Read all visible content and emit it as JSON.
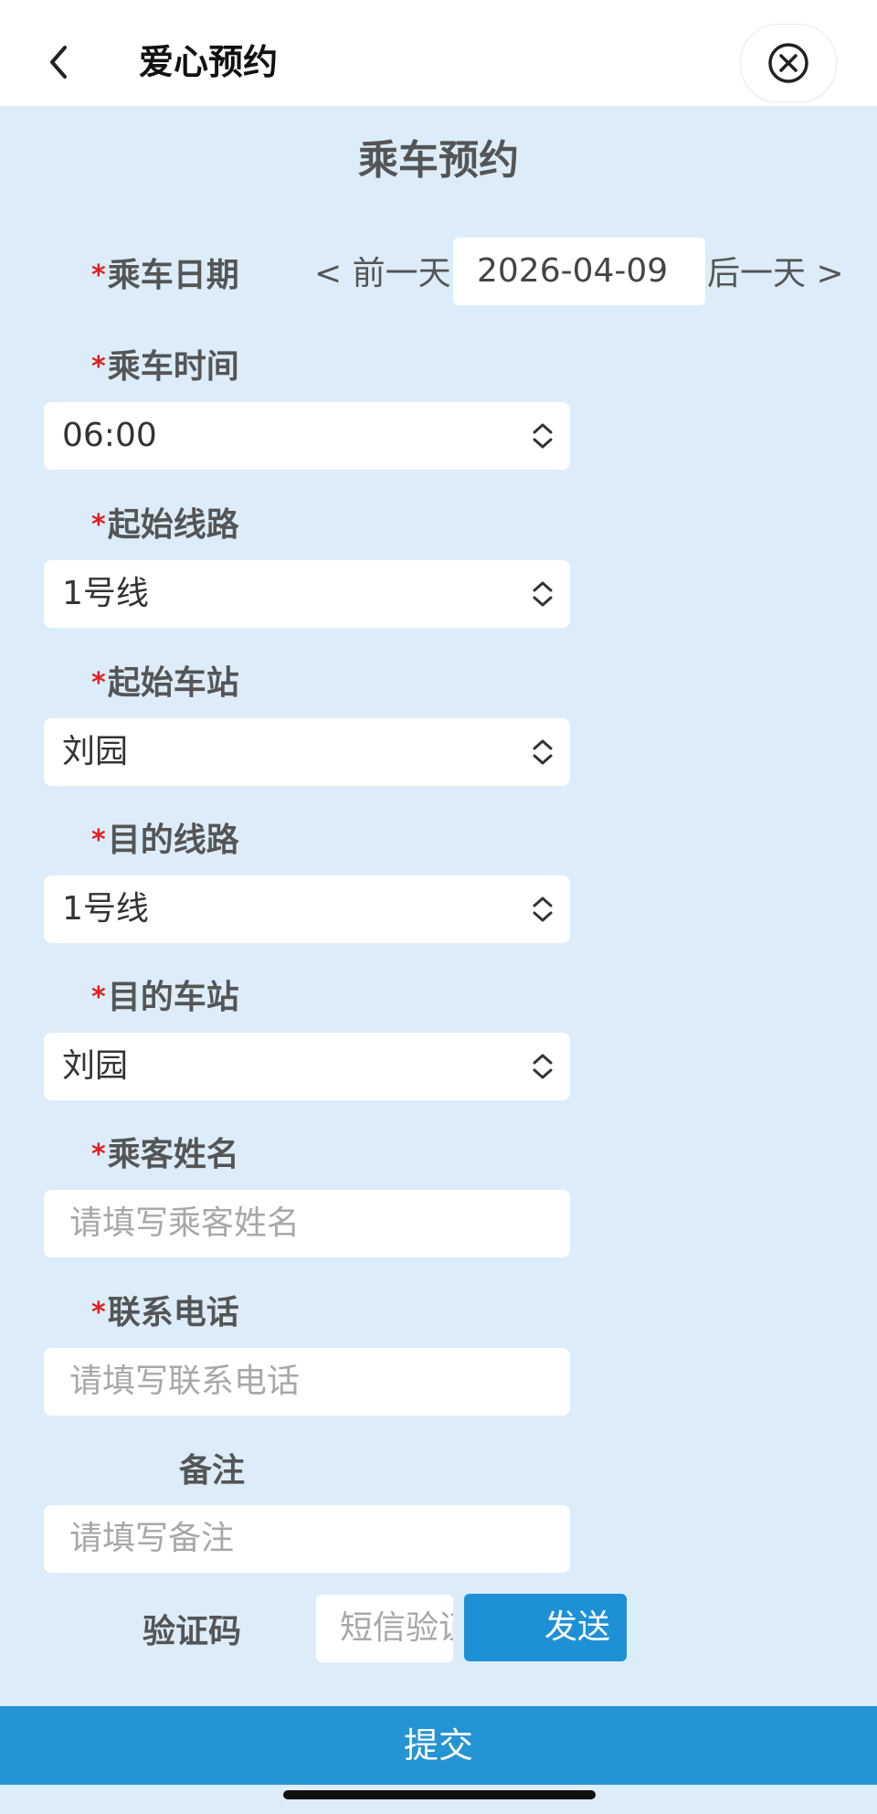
{
  "header": {
    "title": "爱心预约",
    "back_icon": "chevron-left-icon",
    "close_icon": "close-circle-icon"
  },
  "page_title": "乘车预约",
  "required_mark": "*",
  "date": {
    "label": "乘车日期",
    "prev_label": "< 前一天",
    "value": "2026-04-09",
    "next_label": "后一天 >"
  },
  "time": {
    "label": "乘车时间",
    "value": "06:00"
  },
  "start_line": {
    "label": "起始线路",
    "value": "1号线"
  },
  "start_station": {
    "label": "起始车站",
    "value": "刘园"
  },
  "dest_line": {
    "label": "目的线路",
    "value": "1号线"
  },
  "dest_station": {
    "label": "目的车站",
    "value": "刘园"
  },
  "passenger_name": {
    "label": "乘客姓名",
    "placeholder": "请填写乘客姓名"
  },
  "phone": {
    "label": "联系电话",
    "placeholder": "请填写联系电话"
  },
  "remark": {
    "label": "备注",
    "placeholder": "请填写备注"
  },
  "verify": {
    "label": "验证码",
    "placeholder": "短信验证码",
    "send_label": "发送"
  },
  "submit_label": "提交",
  "colors": {
    "background": "#dcedf9",
    "required": "#e02020",
    "primary": "#2594d5"
  }
}
